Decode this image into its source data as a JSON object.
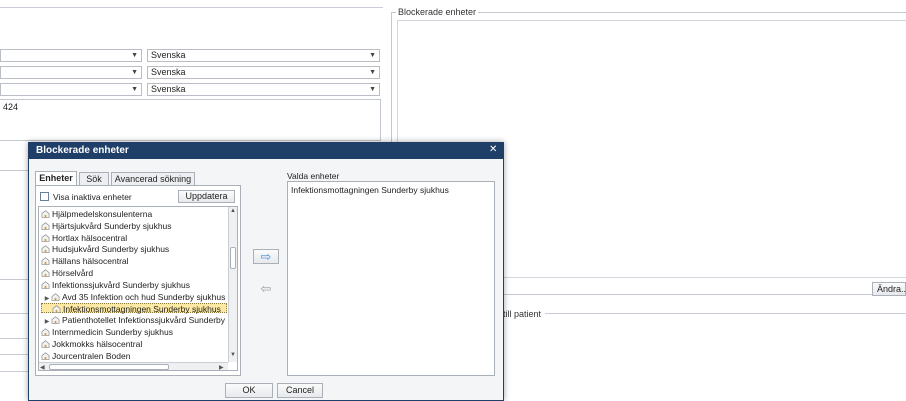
{
  "background": {
    "combos": [
      {
        "left": "",
        "right": "Svenska"
      },
      {
        "left": "",
        "right": "Svenska"
      },
      {
        "left": "",
        "right": "Svenska"
      }
    ],
    "text_area_value": "424",
    "blocked_units_group_title": "Blockerade enheter",
    "change_button": "Ändra...",
    "patient_group_title": "till patient"
  },
  "dialog": {
    "title": "Blockerade enheter",
    "close": "✕",
    "tabs": [
      "Enheter",
      "Sök",
      "Avancerad sökning"
    ],
    "active_tab": "Enheter",
    "show_inactive_label": "Visa inaktiva enheter",
    "show_inactive_checked": false,
    "refresh_button": "Uppdatera",
    "tree_items": [
      {
        "label": "Hjälpmedelskonsulenterna",
        "indent": 0,
        "expander": "",
        "selected": false
      },
      {
        "label": "Hjärtsjukvård Sunderby sjukhus",
        "indent": 0,
        "expander": "",
        "selected": false
      },
      {
        "label": "Hortlax hälsocentral",
        "indent": 0,
        "expander": "",
        "selected": false
      },
      {
        "label": "Hudsjukvård Sunderby sjukhus",
        "indent": 0,
        "expander": "",
        "selected": false
      },
      {
        "label": "Hällans hälsocentral",
        "indent": 0,
        "expander": "",
        "selected": false
      },
      {
        "label": "Hörselvård",
        "indent": 0,
        "expander": "",
        "selected": false
      },
      {
        "label": "Infektionssjukvård Sunderby sjukhus",
        "indent": 0,
        "expander": "",
        "selected": false
      },
      {
        "label": "Avd 35 Infektion och hud Sunderby sjukhus",
        "indent": 1,
        "expander": "▶",
        "selected": false
      },
      {
        "label": "Infektionsmottagningen Sunderby sjukhus",
        "indent": 1,
        "expander": "",
        "selected": true
      },
      {
        "label": "Patienthotellet Infektionssjukvård Sunderby",
        "indent": 1,
        "expander": "▶",
        "selected": false
      },
      {
        "label": "Internmedicin Sunderby sjukhus",
        "indent": 0,
        "expander": "",
        "selected": false
      },
      {
        "label": "Jokkmokks hälsocentral",
        "indent": 0,
        "expander": "",
        "selected": false
      },
      {
        "label": "Jourcentralen Boden",
        "indent": 0,
        "expander": "",
        "selected": false
      }
    ],
    "add_arrow": "⇨",
    "remove_arrow": "⇦",
    "selected_units_label": "Valda enheter",
    "selected_units": [
      "Infektionsmottagningen Sunderby sjukhus"
    ],
    "ok_button": "OK",
    "cancel_button": "Cancel",
    "colors": {
      "titlebar": "#1f3f68",
      "selection": "#fde9a3",
      "arrow_add": "#4a90d9",
      "arrow_remove": "#9aa0a6"
    }
  }
}
